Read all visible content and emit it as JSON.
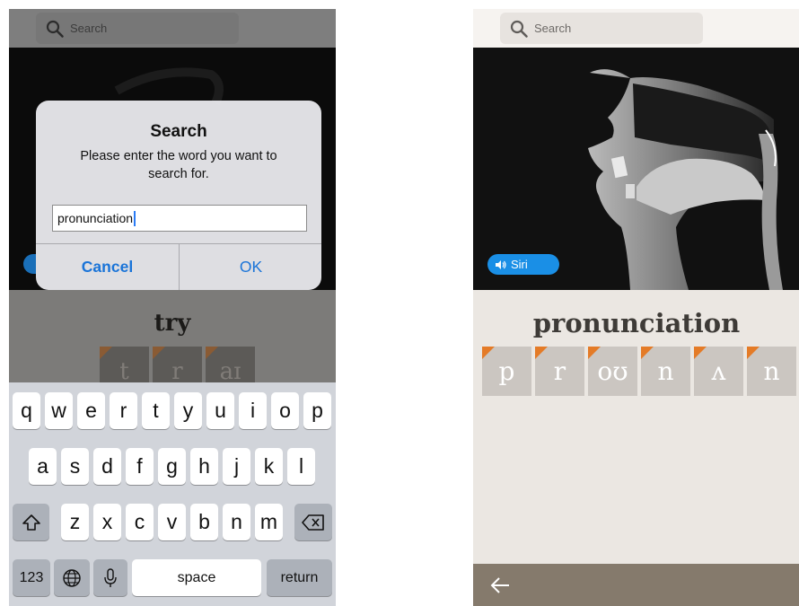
{
  "left_screen": {
    "search": {
      "placeholder": "Search"
    },
    "dialog": {
      "title": "Search",
      "message": "Please enter the word you want to search for.",
      "input_value": "pronunciation",
      "cancel_label": "Cancel",
      "ok_label": "OK"
    },
    "word": "try",
    "phonemes": [
      "t",
      "r",
      "aɪ"
    ],
    "keyboard": {
      "row1": [
        "q",
        "w",
        "e",
        "r",
        "t",
        "y",
        "u",
        "i",
        "o",
        "p"
      ],
      "row2": [
        "a",
        "s",
        "d",
        "f",
        "g",
        "h",
        "j",
        "k",
        "l"
      ],
      "row3": [
        "z",
        "x",
        "c",
        "v",
        "b",
        "n",
        "m"
      ],
      "numbers_label": "123",
      "space_label": "space",
      "return_label": "return"
    }
  },
  "right_screen": {
    "search": {
      "placeholder": "Search"
    },
    "voice_badge": "Siri",
    "word": "pronunciation",
    "phonemes": [
      "p",
      "r",
      "oʊ",
      "n",
      "ʌ",
      "n"
    ]
  },
  "colors": {
    "accent_blue": "#1a74d8",
    "siri_blue": "#1a8fe6",
    "phoneme_corner": "#e47b27",
    "bottom_bar": "#857a6c"
  },
  "icons": {
    "search": "magnifier-icon",
    "shift": "shift-arrow-icon",
    "delete": "backspace-icon",
    "globe": "globe-icon",
    "mic": "microphone-icon",
    "speaker": "speaker-icon",
    "back": "left-arrow-icon"
  }
}
